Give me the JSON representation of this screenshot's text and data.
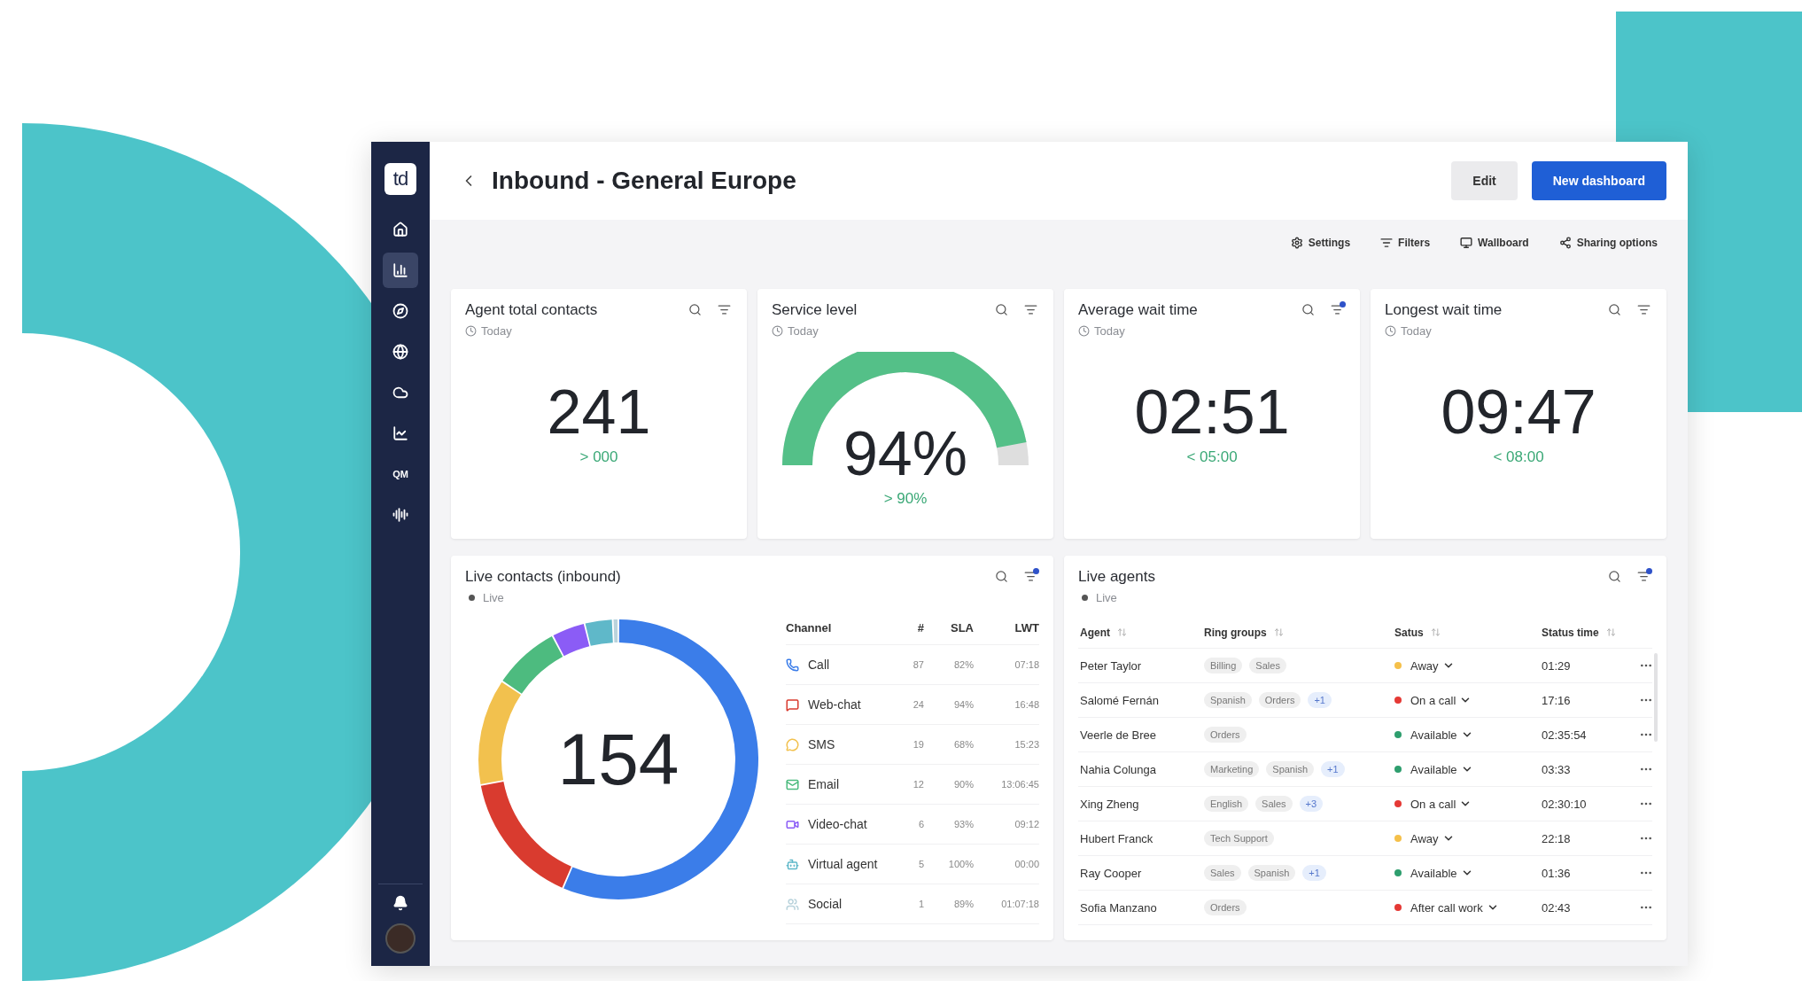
{
  "window": {
    "title": "Inbound - General Europe"
  },
  "logo": "td",
  "nav": [
    {
      "selected": false
    },
    {
      "selected": true
    },
    {
      "selected": false
    },
    {
      "selected": false
    },
    {
      "selected": false
    },
    {
      "selected": false
    },
    {
      "selected": false,
      "label": "QM"
    },
    {
      "selected": false
    }
  ],
  "header_buttons": [
    {
      "label": "Edit",
      "kind": "secondary"
    },
    {
      "label": "New dashboard",
      "kind": "primary"
    }
  ],
  "toolbar": [
    "Settings",
    "Filters",
    "Wallboard",
    "Sharing options"
  ],
  "kpis": [
    {
      "title": "Agent total contacts",
      "period": "Today",
      "value": "241",
      "target": "> 000",
      "filter_active": false,
      "kind": "number"
    },
    {
      "title": "Service level",
      "period": "Today",
      "value": "94%",
      "target": "> 90%",
      "filter_active": false,
      "kind": "gauge",
      "level": 0.94
    },
    {
      "title": "Average wait time",
      "period": "Today",
      "value": "02:51",
      "target": "< 05:00",
      "filter_active": true,
      "kind": "number"
    },
    {
      "title": "Longest wait time",
      "period": "Today",
      "value": "09:47",
      "target": "< 08:00",
      "filter_active": false,
      "kind": "number"
    }
  ],
  "live_contacts": {
    "title": "Live contacts (inbound)",
    "status": "Live",
    "filter_active": true,
    "total": "154",
    "columns": [
      "Channel",
      "#",
      "SLA",
      "LWT"
    ],
    "rows": [
      {
        "channel": "Call",
        "count": "87",
        "sla": "82%",
        "lwt": "07:18",
        "color": "#3b7de9"
      },
      {
        "channel": "Web-chat",
        "count": "24",
        "sla": "94%",
        "lwt": "16:48",
        "color": "#d93b2f"
      },
      {
        "channel": "SMS",
        "count": "19",
        "sla": "68%",
        "lwt": "15:23",
        "color": "#f2c14e"
      },
      {
        "channel": "Email",
        "count": "12",
        "sla": "90%",
        "lwt": "13:06:45",
        "color": "#4dbb7f"
      },
      {
        "channel": "Video-chat",
        "count": "6",
        "sla": "93%",
        "lwt": "09:12",
        "color": "#8b5cf6"
      },
      {
        "channel": "Virtual agent",
        "count": "5",
        "sla": "100%",
        "lwt": "00:00",
        "color": "#5fb8c9"
      },
      {
        "channel": "Social",
        "count": "1",
        "sla": "89%",
        "lwt": "01:07:18",
        "color": "#b9d3dc"
      }
    ]
  },
  "live_agents": {
    "title": "Live agents",
    "status": "Live",
    "filter_active": true,
    "columns": [
      "Agent",
      "Ring groups",
      "Satus",
      "Status time"
    ],
    "rows": [
      {
        "agent": "Peter Taylor",
        "groups": [
          {
            "label": "Billing",
            "kind": "group"
          },
          {
            "label": "Sales",
            "kind": "group"
          }
        ],
        "status": "Away",
        "color": "#f5c04a",
        "time": "01:29"
      },
      {
        "agent": "Salomé Fernán",
        "groups": [
          {
            "label": "Spanish",
            "kind": "group"
          },
          {
            "label": "Orders",
            "kind": "group"
          },
          {
            "label": "+1",
            "kind": "more"
          }
        ],
        "status": "On a call",
        "color": "#e53935",
        "time": "17:16"
      },
      {
        "agent": "Veerle de Bree",
        "groups": [
          {
            "label": "Orders",
            "kind": "group"
          }
        ],
        "status": "Available",
        "color": "#2e9e6e",
        "time": "02:35:54"
      },
      {
        "agent": "Nahia Colunga",
        "groups": [
          {
            "label": "Marketing",
            "kind": "group"
          },
          {
            "label": "Spanish",
            "kind": "group"
          },
          {
            "label": "+1",
            "kind": "more"
          }
        ],
        "status": "Available",
        "color": "#2e9e6e",
        "time": "03:33"
      },
      {
        "agent": "Xing Zheng",
        "groups": [
          {
            "label": "English",
            "kind": "group"
          },
          {
            "label": "Sales",
            "kind": "group"
          },
          {
            "label": "+3",
            "kind": "more"
          }
        ],
        "status": "On a call",
        "color": "#e53935",
        "time": "02:30:10"
      },
      {
        "agent": "Hubert Franck",
        "groups": [
          {
            "label": "Tech Support",
            "kind": "group"
          }
        ],
        "status": "Away",
        "color": "#f5c04a",
        "time": "22:18"
      },
      {
        "agent": "Ray Cooper",
        "groups": [
          {
            "label": "Sales",
            "kind": "group"
          },
          {
            "label": "Spanish",
            "kind": "group"
          },
          {
            "label": "+1",
            "kind": "more"
          }
        ],
        "status": "Available",
        "color": "#2e9e6e",
        "time": "01:36"
      },
      {
        "agent": "Sofia Manzano",
        "groups": [
          {
            "label": "Orders",
            "kind": "group"
          }
        ],
        "status": "After call work",
        "color": "#e53935",
        "time": "02:43"
      }
    ]
  }
}
